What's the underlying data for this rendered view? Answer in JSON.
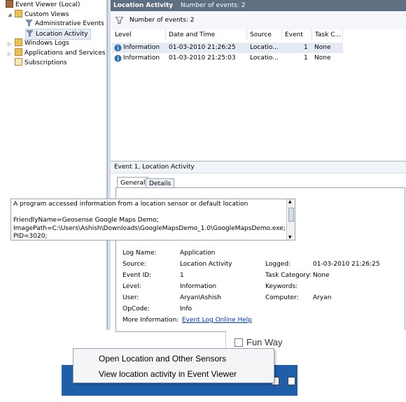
{
  "tree": {
    "items": [
      {
        "label": "Event Viewer (Local)"
      },
      {
        "label": "Custom Views"
      },
      {
        "label": "Administrative Events"
      },
      {
        "label": "Location Activity"
      },
      {
        "label": "Windows Logs"
      },
      {
        "label": "Applications and Services Lo"
      },
      {
        "label": "Subscriptions"
      }
    ]
  },
  "pane_header": {
    "title": "Location Activity",
    "count": "Number of events: 2"
  },
  "filter_bar": {
    "text": "Number of events: 2"
  },
  "grid": {
    "columns": [
      "Level",
      "Date and Time",
      "Source",
      "Event ID",
      "Task C..."
    ],
    "rows": [
      {
        "level": "Information",
        "date": "01-03-2010 21:26:25",
        "source": "Locatio...",
        "event_id": "1",
        "task": "None"
      },
      {
        "level": "Information",
        "date": "01-03-2010 21:25:03",
        "source": "Locatio...",
        "event_id": "1",
        "task": "None"
      }
    ]
  },
  "detail": {
    "title": "Event 1, Location Activity",
    "tabs": [
      "General",
      "Details"
    ],
    "message_lines": [
      "A program accessed information from a location sensor or default location",
      "",
      "FriendlyName=Geosense Google Maps Demo;",
      "ImagePath=C:\\Users\\Ashish\\Downloads\\GoogleMapsDemo_1.0\\GoogleMapsDemo.exe;",
      "PID=3020;"
    ],
    "props": {
      "log_name_label": "Log Name:",
      "log_name": "Application",
      "source_label": "Source:",
      "source": "Location Activity",
      "logged_label": "Logged:",
      "logged": "01-03-2010 21:26:25",
      "event_id_label": "Event ID:",
      "event_id": "1",
      "task_label": "Task Category:",
      "task": "None",
      "level_label": "Level:",
      "level": "Information",
      "keywords_label": "Keywords:",
      "user_label": "User:",
      "user": "Aryan\\Ashish",
      "computer_label": "Computer:",
      "computer": "Aryan",
      "opcode_label": "OpCode:",
      "opcode": "Info",
      "more_label": "More Information:",
      "more_link": "Event Log Online Help"
    }
  },
  "bottom": {
    "checkbox_label": "Fun Way",
    "menu": [
      "Open Location and Other Sensors",
      "View location activity in Event Viewer"
    ]
  },
  "colors": {
    "header": "#5f6f82",
    "taskbar": "#1f5ea8",
    "link": "#0033cc"
  }
}
